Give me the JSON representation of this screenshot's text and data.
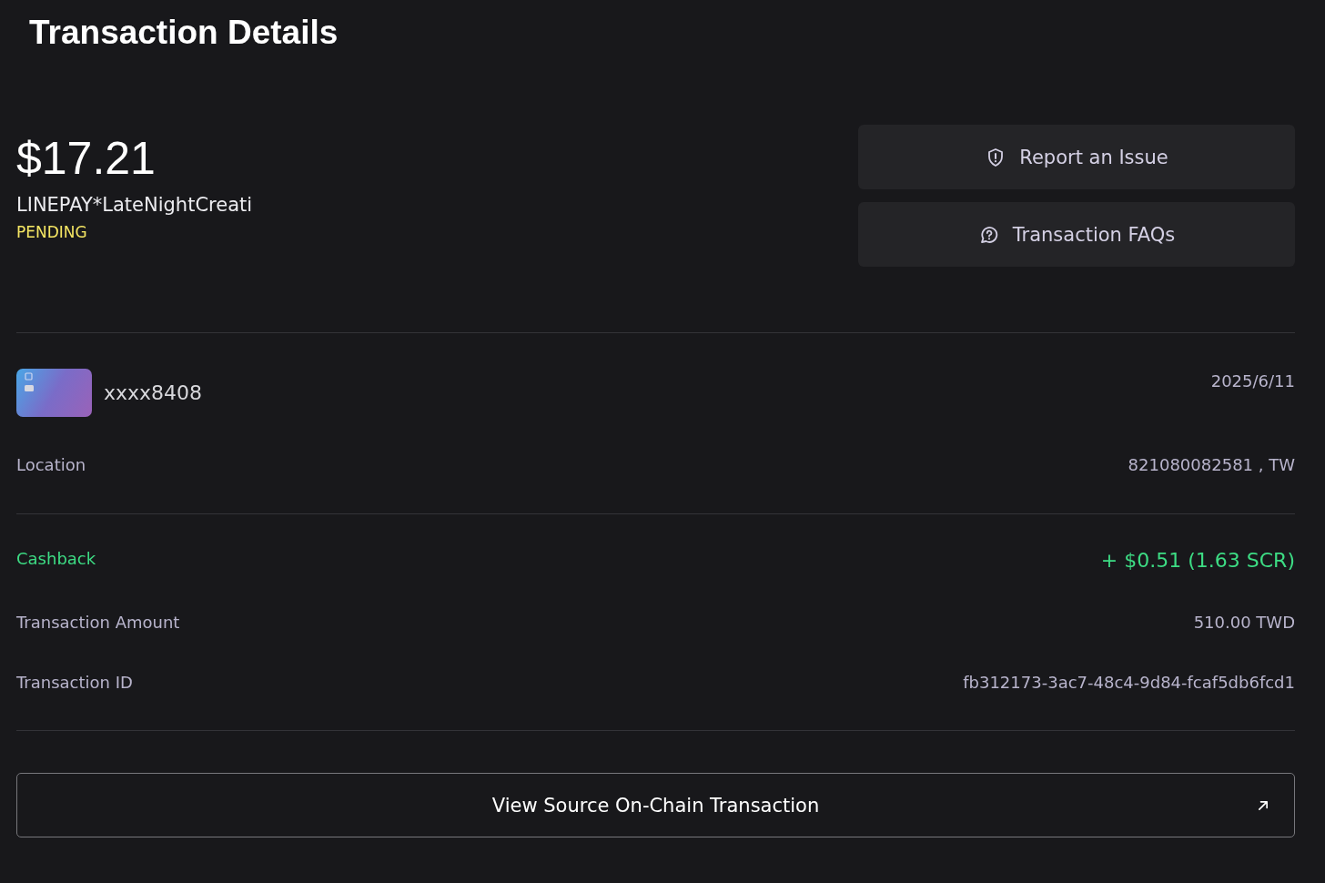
{
  "page": {
    "title": "Transaction Details"
  },
  "summary": {
    "amount": "$17.21",
    "merchant": "LINEPAY*LateNightCreati",
    "status": {
      "label": "PENDING",
      "kind": "pending"
    }
  },
  "actions": [
    {
      "label": "Report an Issue",
      "kind": "report"
    },
    {
      "label": "Transaction FAQs",
      "kind": "faq"
    }
  ],
  "card": {
    "number": "xxxx8408",
    "date": "2025/6/11"
  },
  "location": {
    "label": "Location",
    "value": "821080082581 , TW"
  },
  "details": [
    {
      "label": "Cashback",
      "value": "+ $0.51 (1.63 SCR)",
      "kind": "cashback"
    },
    {
      "label": "Transaction Amount",
      "value": "510.00 TWD",
      "kind": "plain"
    },
    {
      "label": "Transaction ID",
      "value": "fb312173-3ac7-48c4-9d84-fcaf5db6fcd1",
      "kind": "plain"
    }
  ],
  "footer_button": {
    "label": "View Source On-Chain Transaction"
  }
}
